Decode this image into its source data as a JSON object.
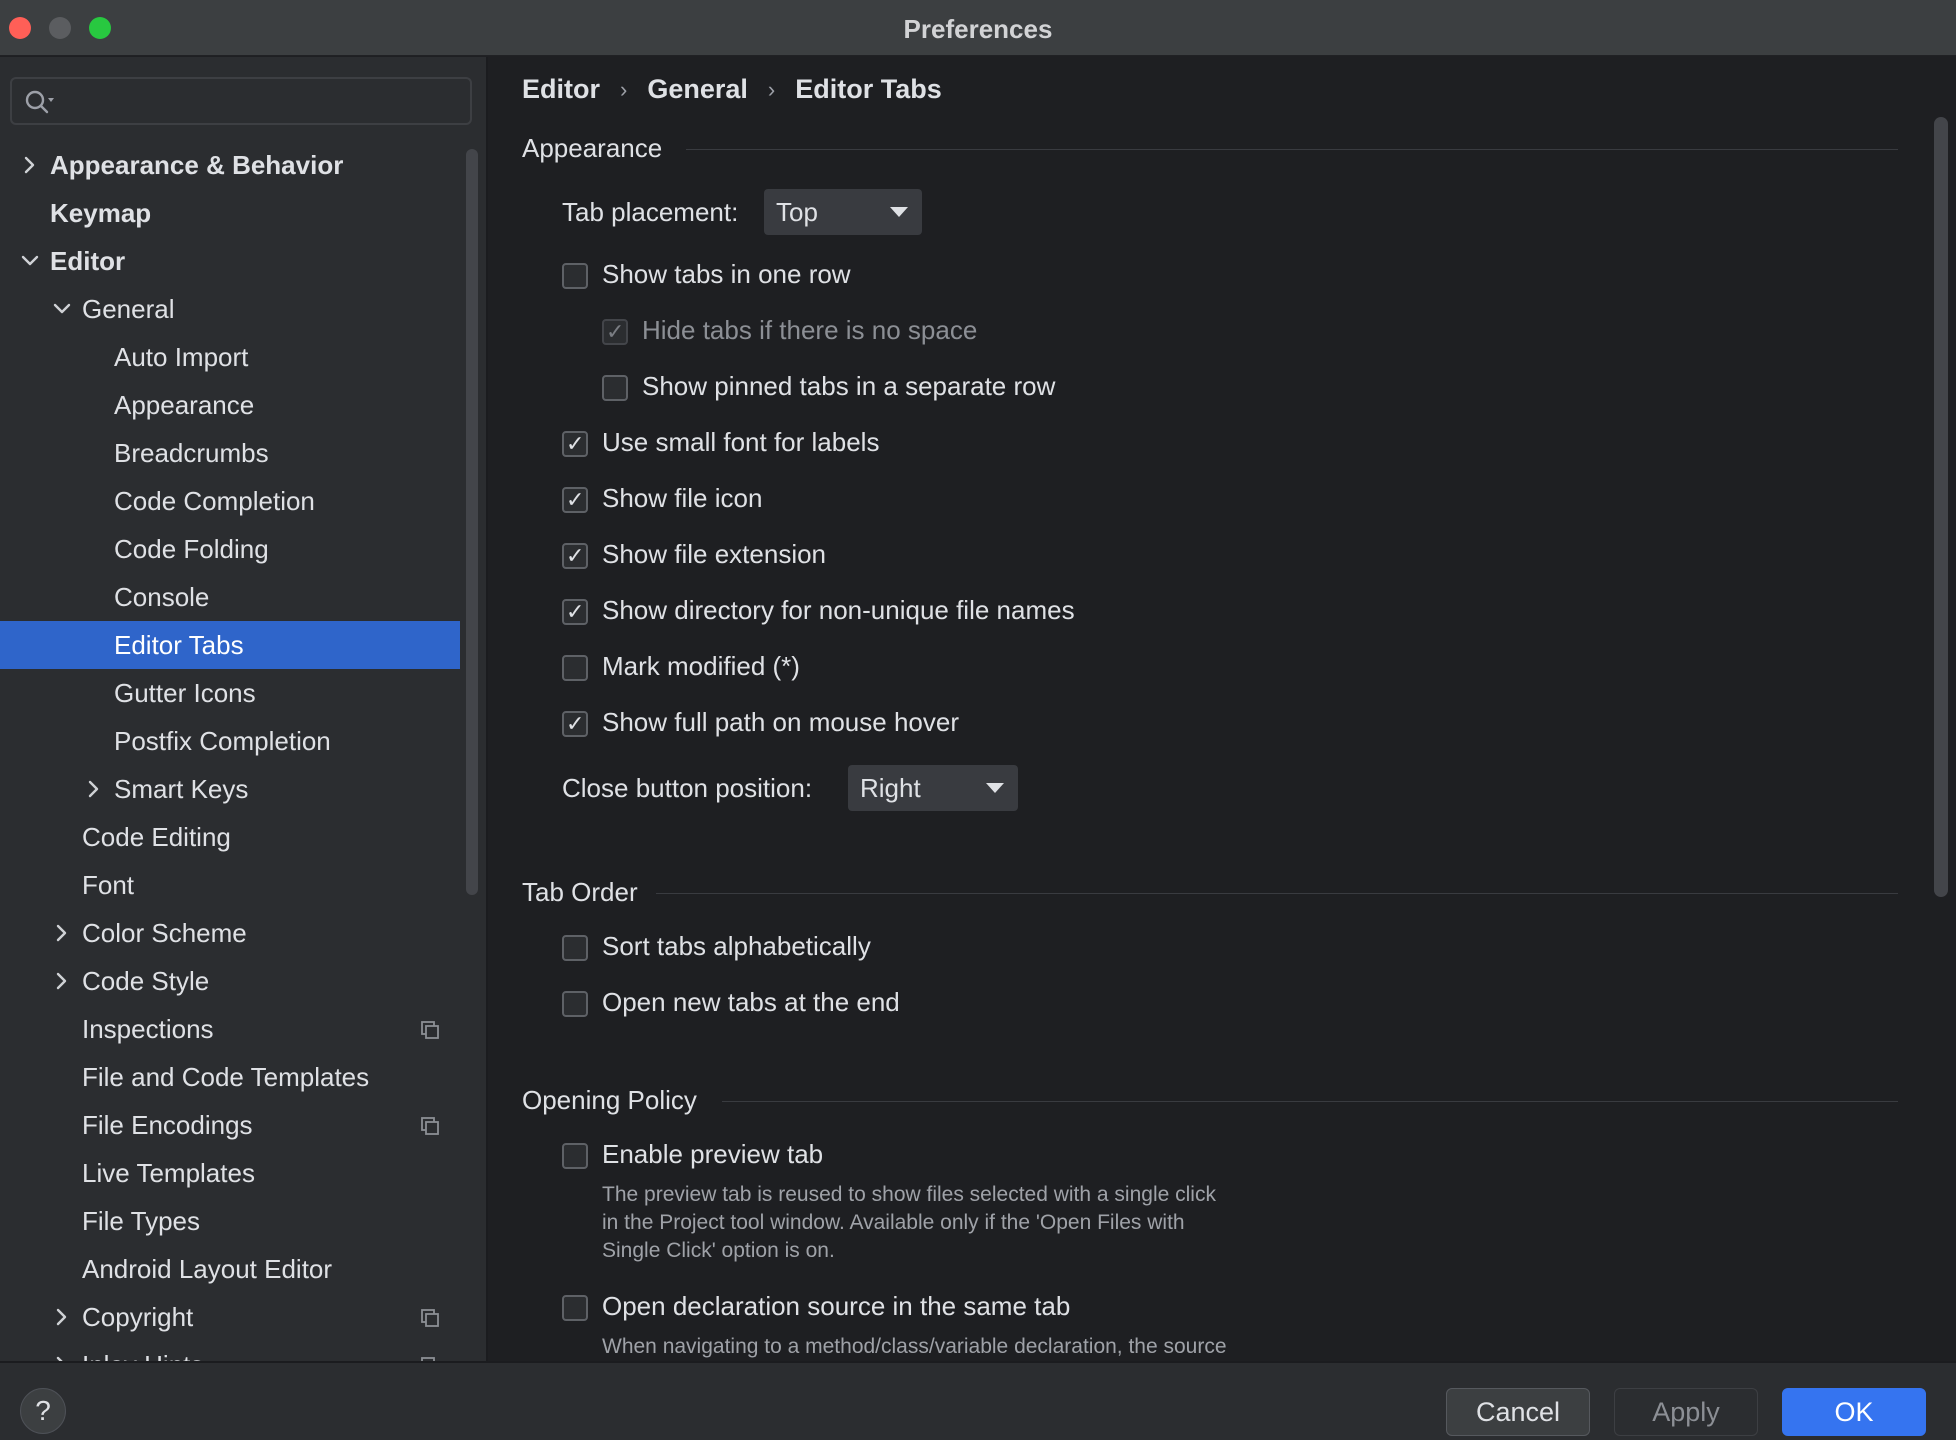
{
  "window": {
    "title": "Preferences"
  },
  "search": {
    "placeholder": "",
    "icon": "search-icon"
  },
  "sidebar": {
    "items": [
      {
        "label": "Appearance & Behavior",
        "level": 0,
        "expander": "collapsed",
        "bold": true
      },
      {
        "label": "Keymap",
        "level": 0,
        "expander": "none",
        "bold": true
      },
      {
        "label": "Editor",
        "level": 0,
        "expander": "expanded",
        "bold": true
      },
      {
        "label": "General",
        "level": 1,
        "expander": "expanded"
      },
      {
        "label": "Auto Import",
        "level": 2,
        "expander": "none"
      },
      {
        "label": "Appearance",
        "level": 2,
        "expander": "none"
      },
      {
        "label": "Breadcrumbs",
        "level": 2,
        "expander": "none"
      },
      {
        "label": "Code Completion",
        "level": 2,
        "expander": "none"
      },
      {
        "label": "Code Folding",
        "level": 2,
        "expander": "none"
      },
      {
        "label": "Console",
        "level": 2,
        "expander": "none"
      },
      {
        "label": "Editor Tabs",
        "level": 2,
        "expander": "none",
        "selected": true
      },
      {
        "label": "Gutter Icons",
        "level": 2,
        "expander": "none"
      },
      {
        "label": "Postfix Completion",
        "level": 2,
        "expander": "none"
      },
      {
        "label": "Smart Keys",
        "level": 2,
        "expander": "collapsed"
      },
      {
        "label": "Code Editing",
        "level": 1,
        "expander": "none"
      },
      {
        "label": "Font",
        "level": 1,
        "expander": "none"
      },
      {
        "label": "Color Scheme",
        "level": 1,
        "expander": "collapsed"
      },
      {
        "label": "Code Style",
        "level": 1,
        "expander": "collapsed"
      },
      {
        "label": "Inspections",
        "level": 1,
        "expander": "none",
        "badge": "project-settings-icon"
      },
      {
        "label": "File and Code Templates",
        "level": 1,
        "expander": "none"
      },
      {
        "label": "File Encodings",
        "level": 1,
        "expander": "none",
        "badge": "project-settings-icon"
      },
      {
        "label": "Live Templates",
        "level": 1,
        "expander": "none"
      },
      {
        "label": "File Types",
        "level": 1,
        "expander": "none"
      },
      {
        "label": "Android Layout Editor",
        "level": 1,
        "expander": "none"
      },
      {
        "label": "Copyright",
        "level": 1,
        "expander": "collapsed",
        "badge": "project-settings-icon"
      },
      {
        "label": "Inlay Hints",
        "level": 1,
        "expander": "collapsed",
        "badge": "project-settings-icon"
      }
    ]
  },
  "breadcrumb": {
    "items": [
      "Editor",
      "General",
      "Editor Tabs"
    ],
    "separator": "›"
  },
  "sections": {
    "appearance": "Appearance",
    "tab_order": "Tab Order",
    "opening_policy": "Opening Policy"
  },
  "tab_placement": {
    "label": "Tab placement:",
    "value": "Top"
  },
  "close_button_position": {
    "label": "Close button position:",
    "value": "Right"
  },
  "checkboxes": {
    "show_tabs_one_row": {
      "label": "Show tabs in one row",
      "checked": false
    },
    "hide_tabs_no_space": {
      "label": "Hide tabs if there is no space",
      "checked": true,
      "disabled": true
    },
    "show_pinned_separate_row": {
      "label": "Show pinned tabs in a separate row",
      "checked": false
    },
    "small_font_labels": {
      "label": "Use small font for labels",
      "checked": true
    },
    "show_file_icon": {
      "label": "Show file icon",
      "checked": true
    },
    "show_file_extension": {
      "label": "Show file extension",
      "checked": true
    },
    "show_directory_nonunique": {
      "label": "Show directory for non-unique file names",
      "checked": true
    },
    "mark_modified": {
      "label": "Mark modified (*)",
      "checked": false
    },
    "show_full_path_hover": {
      "label": "Show full path on mouse hover",
      "checked": true
    },
    "sort_alphabetically": {
      "label": "Sort tabs alphabetically",
      "checked": false
    },
    "open_new_at_end": {
      "label": "Open new tabs at the end",
      "checked": false
    },
    "enable_preview_tab": {
      "label": "Enable preview tab",
      "checked": false
    },
    "open_declaration_same_tab": {
      "label": "Open declaration source in the same tab",
      "checked": false
    }
  },
  "descriptions": {
    "preview_tab": [
      "The preview tab is reused to show files selected with a single click",
      "in the Project tool window. Available only if the 'Open Files with",
      "Single Click' option is on."
    ],
    "declaration": "When navigating to a method/class/variable declaration, the source"
  },
  "footer": {
    "help": "?",
    "cancel": "Cancel",
    "apply": "Apply",
    "ok": "OK"
  },
  "colors": {
    "selection": "#2f65ca",
    "ok_button": "#3574f0",
    "traffic_red": "#ff5f57",
    "traffic_green": "#28c840"
  }
}
